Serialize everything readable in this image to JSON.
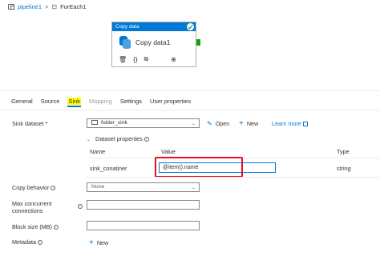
{
  "breadcrumb": {
    "pipeline": "pipeline1",
    "separator": ">",
    "current": "ForEach1"
  },
  "activity": {
    "type_label": "Copy data",
    "name": "Copy data1",
    "status": "succeeded",
    "tools": [
      "delete-icon",
      "code-icon",
      "copy-icon",
      "arrow-icon"
    ]
  },
  "tabs": [
    {
      "label": "General",
      "state": "normal"
    },
    {
      "label": "Source",
      "state": "normal"
    },
    {
      "label": "Sink",
      "state": "active"
    },
    {
      "label": "Mapping",
      "state": "disabled"
    },
    {
      "label": "Settings",
      "state": "normal"
    },
    {
      "label": "User properties",
      "state": "normal"
    }
  ],
  "sink": {
    "dataset_label": "Sink dataset",
    "required_mark": "*",
    "dataset_value": "folder_sink",
    "open_label": "Open",
    "new_label": "New",
    "learn_more": "Learn more",
    "dataset_properties_label": "Dataset properties",
    "columns": {
      "name": "Name",
      "value": "Value",
      "type": "Type"
    },
    "property": {
      "name": "sink_conatiner",
      "value": "@item().name",
      "type": "string"
    },
    "copy_behavior_label": "Copy behavior",
    "copy_behavior_value": "None",
    "max_connections_label_1": "Max concurrent",
    "max_connections_label_2": "connections",
    "block_size_label": "Block size (MB)",
    "metadata_label": "Metadata",
    "metadata_new": "New"
  },
  "colors": {
    "accent": "#0078d4",
    "highlight": "#ffff00",
    "annotation": "#e81123",
    "success": "#107c10"
  }
}
